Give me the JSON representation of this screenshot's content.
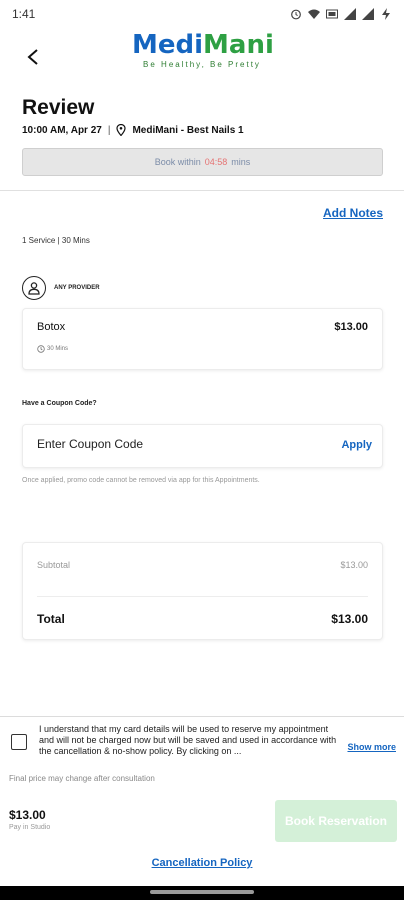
{
  "status_bar": {
    "time": "1:41"
  },
  "logo": {
    "medi": "Medi",
    "mani": "Mani",
    "tagline": "Be Healthy, Be Pretty"
  },
  "header": {
    "title": "Review",
    "datetime": "10:00 AM, Apr 27",
    "separator": "|",
    "location": "MediMani - Best Nails 1"
  },
  "booking_timer": {
    "prefix": "Book within",
    "timer": "04:58",
    "suffix": "mins"
  },
  "notes": {
    "add_notes_label": "Add Notes"
  },
  "service_summary": "1 Service | 30 Mins",
  "provider": {
    "label": "ANY PROVIDER"
  },
  "service": {
    "name": "Botox",
    "price": "$13.00",
    "duration": "30 Mins"
  },
  "coupon": {
    "question": "Have a Coupon Code?",
    "placeholder": "Enter Coupon Code",
    "apply_label": "Apply",
    "note": "Once applied, promo code cannot be removed via app for this Appointments."
  },
  "totals": {
    "subtotal_label": "Subtotal",
    "subtotal_value": "$13.00",
    "total_label": "Total",
    "total_value": "$13.00"
  },
  "agreement": {
    "text": "I understand that my card details will be used to reserve my appointment and will not be charged now but will be saved and used in accordance with the cancellation & no-show policy. By clicking on ...",
    "show_more_label": "Show more",
    "checked": false
  },
  "footer": {
    "final_note": "Final price may change after consultation",
    "price": "$13.00",
    "price_sub": "Pay in Studio",
    "book_label": "Book Reservation",
    "cancellation_label": "Cancellation Policy"
  },
  "colors": {
    "brand_blue": "#1565c0",
    "brand_green": "#2ea043",
    "timer_red": "#e57373",
    "disabled_green": "#d4f0d8"
  },
  "icons": [
    "back-arrow-icon",
    "location-pin-icon",
    "person-icon",
    "clock-icon",
    "alarm-icon",
    "wifi-icon",
    "signal-icon",
    "battery-icon"
  ]
}
